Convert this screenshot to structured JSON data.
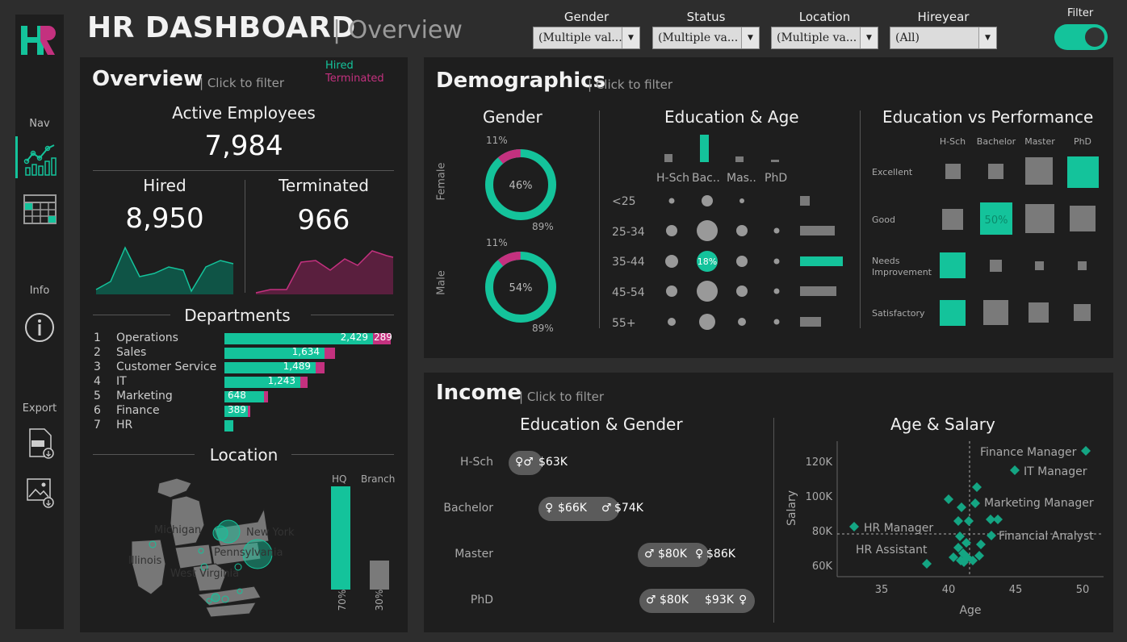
{
  "header": {
    "title": "HR DASHBOARD",
    "separator": "|",
    "subtitle": "Overview",
    "filters": [
      {
        "label": "Gender",
        "value": "(Multiple val..."
      },
      {
        "label": "Status",
        "value": "(Multiple va..."
      },
      {
        "label": "Location",
        "value": "(Multiple va..."
      },
      {
        "label": "Hireyear",
        "value": "(All)"
      }
    ],
    "toggle_label": "Filter",
    "toggle_on": true
  },
  "sidebar": {
    "logo": "HR",
    "nav_label": "Nav",
    "info_label": "Info",
    "export_label": "Export",
    "icons": [
      "line-chart-icon",
      "calendar-table-icon",
      "info-icon",
      "pdf-export-icon",
      "image-export-icon"
    ]
  },
  "overview": {
    "title": "Overview",
    "hint": "| Click to filter",
    "legend_hired": "Hired",
    "legend_terminated": "Terminated",
    "active_label": "Active Employees",
    "active_value": "7,984",
    "hired_label": "Hired",
    "hired_value": "8,950",
    "terminated_label": "Terminated",
    "terminated_value": "966",
    "departments_title": "Departments",
    "departments": [
      {
        "rank": "1",
        "name": "Operations",
        "hired": 2429,
        "hired_label": "2,429",
        "terminated": 289,
        "terminated_label": "289"
      },
      {
        "rank": "2",
        "name": "Sales",
        "hired": 1634,
        "hired_label": "1,634",
        "terminated": 170,
        "terminated_label": ""
      },
      {
        "rank": "3",
        "name": "Customer Service",
        "hired": 1489,
        "hired_label": "1,489",
        "terminated": 150,
        "terminated_label": ""
      },
      {
        "rank": "4",
        "name": "IT",
        "hired": 1243,
        "hired_label": "1,243",
        "terminated": 120,
        "terminated_label": ""
      },
      {
        "rank": "5",
        "name": "Marketing",
        "hired": 648,
        "hired_label": "648",
        "terminated": 60,
        "terminated_label": ""
      },
      {
        "rank": "6",
        "name": "Finance",
        "hired": 389,
        "hired_label": "389",
        "terminated": 40,
        "terminated_label": ""
      },
      {
        "rank": "7",
        "name": "HR",
        "hired": 140,
        "hired_label": "",
        "terminated": 0,
        "terminated_label": ""
      }
    ],
    "location_title": "Location",
    "map_labels": [
      "Michigan",
      "New York",
      "Illinois",
      "Pennsylvania",
      "West Virginia"
    ],
    "hq_label": "HQ",
    "branch_label": "Branch",
    "hq_pct": "70%",
    "branch_pct": "30%",
    "hq_value": 0.7,
    "branch_value": 0.3
  },
  "demographics": {
    "title": "Demographics",
    "hint": "| Click to filter",
    "gender_title": "Gender",
    "female_label": "Female",
    "male_label": "Male",
    "female": {
      "center": "46%",
      "small": "11%",
      "large": "89%"
    },
    "male": {
      "center": "54%",
      "small": "11%",
      "large": "89%"
    },
    "edu_age_title": "Education & Age",
    "edu_levels": [
      "H-Sch",
      "Bac..",
      "Mas..",
      "PhD"
    ],
    "age_groups": [
      "<25",
      "25-34",
      "35-44",
      "45-54",
      "55+"
    ],
    "highlight_label": "18%",
    "edu_perf_title": "Education vs Performance",
    "perf_cols": [
      "H-Sch",
      "Bachelor",
      "Master",
      "PhD"
    ],
    "perf_rows": [
      "Excellent",
      "Good",
      "Needs\nImprovement",
      "Satisfactory"
    ],
    "perf_highlight": "50%"
  },
  "income": {
    "title": "Income",
    "hint": "| Click to filter",
    "edu_gender_title": "Education & Gender",
    "rows": [
      {
        "edu": "H-Sch",
        "label": "$63K"
      },
      {
        "edu": "Bachelor",
        "label_a": "$66K",
        "label_b": "$74K"
      },
      {
        "edu": "Master",
        "label_a": "$80K",
        "label_b": "$86K"
      },
      {
        "edu": "PhD",
        "label_a": "$80K",
        "label_b": "$93K"
      }
    ],
    "age_salary_title": "Age & Salary",
    "y_label": "Salary",
    "x_label": "Age",
    "y_ticks": [
      "120K",
      "100K",
      "80K",
      "60K"
    ],
    "x_ticks": [
      "35",
      "40",
      "45",
      "50"
    ],
    "annotations": [
      "Finance Manager",
      "IT Manager",
      "Marketing Manager",
      "HR Manager",
      "Financial Analyst",
      "HR Assistant"
    ]
  },
  "colors": {
    "teal": "#14c39b",
    "pink": "#c4317f",
    "grey": "#7a7a7a",
    "panel": "#1e1e1e"
  }
}
